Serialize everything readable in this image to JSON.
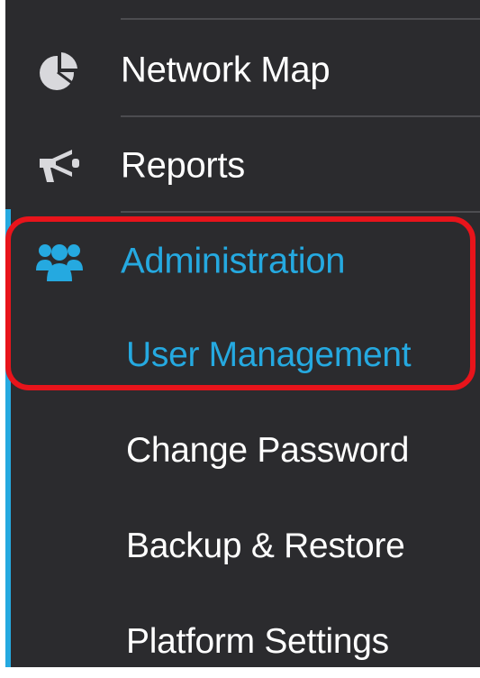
{
  "nav": {
    "items": [
      {
        "label": "Network Map",
        "icon": "pie-chart-icon"
      },
      {
        "label": "Reports",
        "icon": "megaphone-icon"
      },
      {
        "label": "Administration",
        "icon": "users-group-icon",
        "active": true
      }
    ],
    "subitems": [
      {
        "label": "User Management",
        "active": true
      },
      {
        "label": "Change Password"
      },
      {
        "label": "Backup & Restore"
      },
      {
        "label": "Platform Settings"
      }
    ]
  },
  "colors": {
    "sidebar_bg": "#2b2b2e",
    "text": "#ffffff",
    "accent": "#25a9e0",
    "highlight": "#e8141b",
    "icon_inactive": "#d8d8dc"
  }
}
